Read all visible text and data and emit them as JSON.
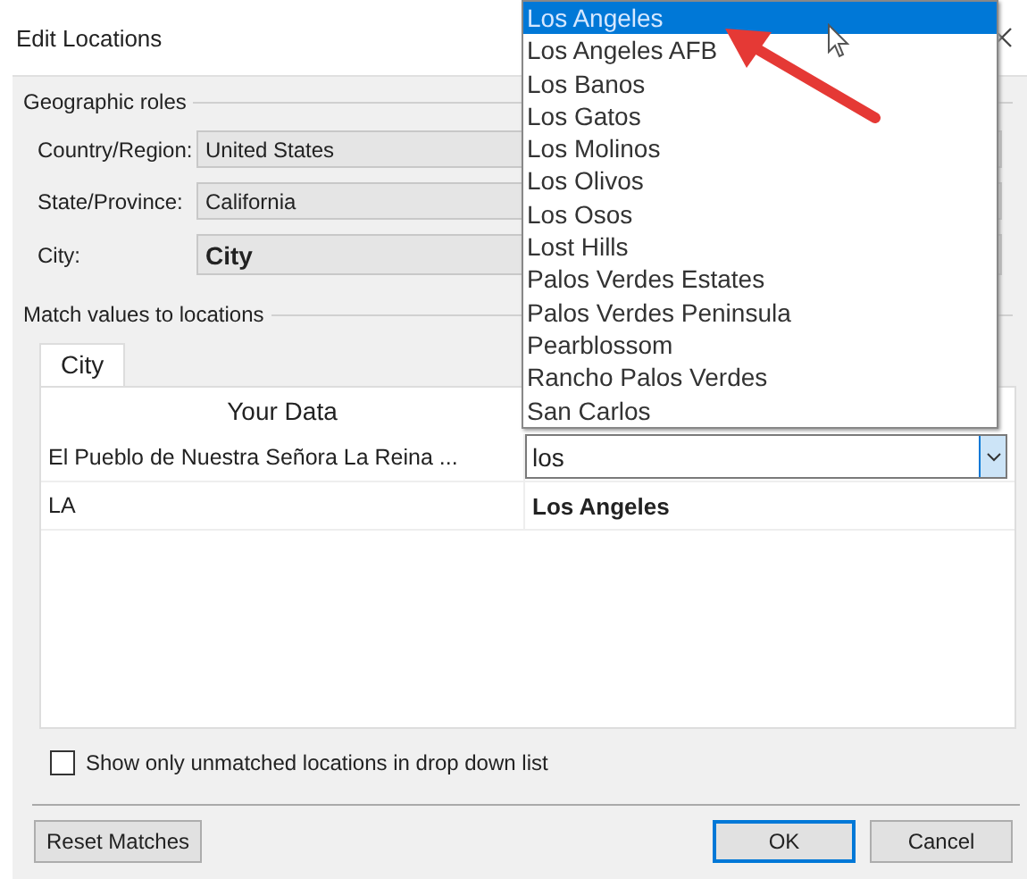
{
  "window": {
    "title": "Edit Locations"
  },
  "geographic_roles": {
    "title": "Geographic roles",
    "fields": [
      {
        "label": "Country/Region:",
        "value": "United States",
        "kind": "plain"
      },
      {
        "label": "State/Province:",
        "value": "California",
        "kind": "plain"
      },
      {
        "label": "City:",
        "value": "City",
        "kind": "prominent"
      }
    ]
  },
  "match": {
    "title": "Match values to locations",
    "tabs": [
      {
        "label": "City",
        "selected": true
      }
    ],
    "column_header": "Your Data",
    "rows": [
      {
        "data": "El Pueblo de Nuestra Señora La Reina ...",
        "match": "los",
        "kind": "editing"
      },
      {
        "data": "LA",
        "match": "Los Angeles",
        "kind": "matched"
      }
    ]
  },
  "dropdown": {
    "items": [
      {
        "label": "Los Angeles",
        "selected": true
      },
      {
        "label": "Los Angeles AFB",
        "selected": false
      },
      {
        "label": "Los Banos",
        "selected": false
      },
      {
        "label": "Los Gatos",
        "selected": false
      },
      {
        "label": "Los Molinos",
        "selected": false
      },
      {
        "label": "Los Olivos",
        "selected": false
      },
      {
        "label": "Los Osos",
        "selected": false
      },
      {
        "label": "Lost Hills",
        "selected": false
      },
      {
        "label": "Palos Verdes Estates",
        "selected": false
      },
      {
        "label": "Palos Verdes Peninsula",
        "selected": false
      },
      {
        "label": "Pearblossom",
        "selected": false
      },
      {
        "label": "Rancho Palos Verdes",
        "selected": false
      },
      {
        "label": "San Carlos",
        "selected": false
      }
    ]
  },
  "unmatched_only": {
    "label": "Show only unmatched locations in drop down list",
    "checked": false
  },
  "buttons": [
    {
      "label": "Reset Matches",
      "default": false
    },
    {
      "label": "OK",
      "default": true
    },
    {
      "label": "Cancel",
      "default": false
    }
  ]
}
